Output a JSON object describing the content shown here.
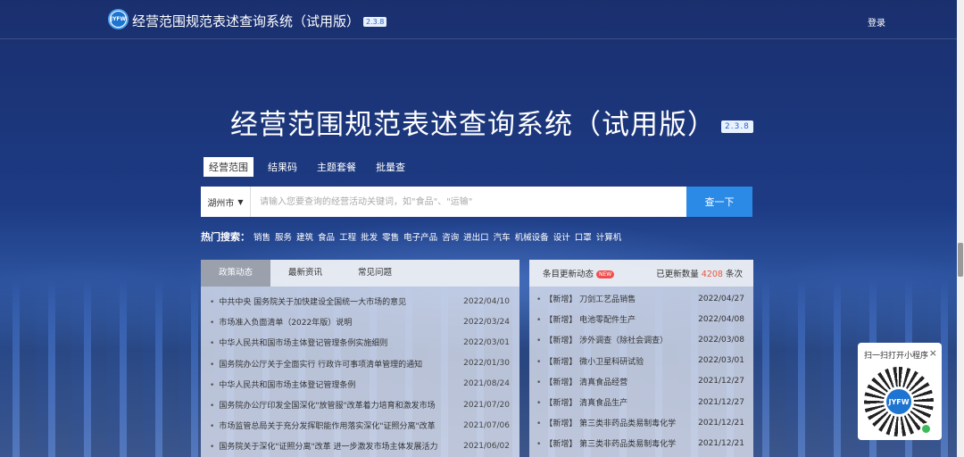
{
  "header": {
    "title": "经营范围规范表述查询系统（试用版）",
    "version": "2.3.8",
    "login": "登录",
    "logo_text": "JYFW"
  },
  "hero": {
    "title": "经营范围规范表述查询系统（试用版）",
    "version": "2.3.8"
  },
  "tabs": [
    "经营范围",
    "结果码",
    "主题套餐",
    "批量查"
  ],
  "search": {
    "city": "湖州市",
    "placeholder": "请输入您要查询的经营活动关键词，如\"食品\"、\"运输\"",
    "button": "查一下"
  },
  "hot": {
    "label": "热门搜索：",
    "items": [
      "销售",
      "服务",
      "建筑",
      "食品",
      "工程",
      "批发",
      "零售",
      "电子产品",
      "咨询",
      "进出口",
      "汽车",
      "机械设备",
      "设计",
      "口罩",
      "计算机"
    ]
  },
  "news_panel": {
    "tabs": [
      "政策动态",
      "最新资讯",
      "常见问题"
    ],
    "items": [
      {
        "title": "中共中央 国务院关于加快建设全国统一大市场的意见",
        "date": "2022/04/10"
      },
      {
        "title": "市场准入负面清单（2022年版）说明",
        "date": "2022/03/24"
      },
      {
        "title": "中华人民共和国市场主体登记管理条例实施细则",
        "date": "2022/03/01"
      },
      {
        "title": "国务院办公厅关于全面实行 行政许可事项清单管理的通知",
        "date": "2022/01/30"
      },
      {
        "title": "中华人民共和国市场主体登记管理条例",
        "date": "2021/08/24"
      },
      {
        "title": "国务院办公厅印发全国深化\"放管服\"改革着力培育和激发市场",
        "date": "2021/07/20"
      },
      {
        "title": "市场监管总局关于充分发挥职能作用落实深化\"证照分离\"改革",
        "date": "2021/07/06"
      },
      {
        "title": "国务院关于深化\"证照分离\"改革 进一步激发市场主体发展活力",
        "date": "2021/06/02"
      }
    ]
  },
  "updates_panel": {
    "title": "条目更新动态",
    "badge": "NEW",
    "count_label": "已更新数量",
    "count": "4208",
    "count_unit": "条次",
    "items": [
      {
        "title": "【新增】 刀剑工艺品销售",
        "date": "2022/04/27"
      },
      {
        "title": "【新增】 电池零配件生产",
        "date": "2022/04/08"
      },
      {
        "title": "【新增】 涉外调查（除社会调查）",
        "date": "2022/03/08"
      },
      {
        "title": "【新增】 微小卫星科研试验",
        "date": "2022/03/01"
      },
      {
        "title": "【新增】 清真食品经营",
        "date": "2021/12/27"
      },
      {
        "title": "【新增】 清真食品生产",
        "date": "2021/12/27"
      },
      {
        "title": "【新增】 第三类非药品类易制毒化学",
        "date": "2021/12/21"
      },
      {
        "title": "【新增】 第三类非药品类易制毒化学",
        "date": "2021/12/21"
      }
    ]
  },
  "mini_program": {
    "title": "扫一扫打开小程序",
    "close": "×",
    "qr_text": "JYFW"
  },
  "colors": {
    "accent": "#2b8ae6",
    "count": "#e9573f",
    "badge": "#f04e4e"
  }
}
